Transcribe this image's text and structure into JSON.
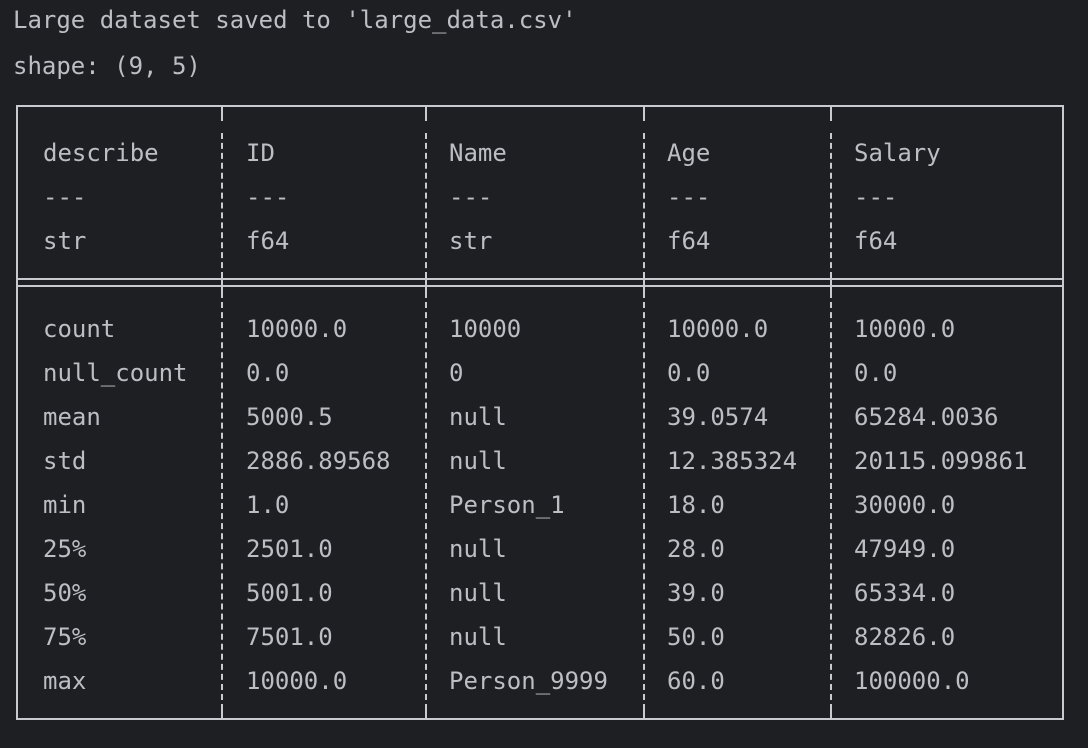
{
  "output": {
    "message": "Large dataset saved to 'large_data.csv'",
    "shape": "shape: (9, 5)"
  },
  "table": {
    "columns": [
      {
        "name": "describe",
        "separator": "---",
        "dtype": "str"
      },
      {
        "name": "ID",
        "separator": "---",
        "dtype": "f64"
      },
      {
        "name": "Name",
        "separator": "---",
        "dtype": "str"
      },
      {
        "name": "Age",
        "separator": "---",
        "dtype": "f64"
      },
      {
        "name": "Salary",
        "separator": "---",
        "dtype": "f64"
      }
    ],
    "rows": [
      [
        "count",
        "10000.0",
        "10000",
        "10000.0",
        "10000.0"
      ],
      [
        "null_count",
        "0.0",
        "0",
        "0.0",
        "0.0"
      ],
      [
        "mean",
        "5000.5",
        "null",
        "39.0574",
        "65284.0036"
      ],
      [
        "std",
        "2886.89568",
        "null",
        "12.385324",
        "20115.099861"
      ],
      [
        "min",
        "1.0",
        "Person_1",
        "18.0",
        "30000.0"
      ],
      [
        "25%",
        "2501.0",
        "null",
        "28.0",
        "47949.0"
      ],
      [
        "50%",
        "5001.0",
        "null",
        "39.0",
        "65334.0"
      ],
      [
        "75%",
        "7501.0",
        "null",
        "50.0",
        "82826.0"
      ],
      [
        "max",
        "10000.0",
        "Person_9999",
        "60.0",
        "100000.0"
      ]
    ]
  }
}
